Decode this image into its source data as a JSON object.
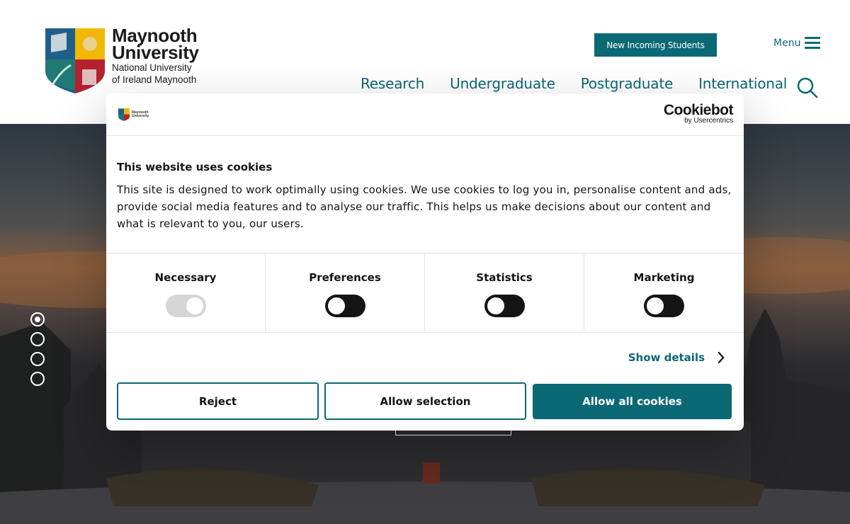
{
  "header": {
    "logo": {
      "name_line1": "Maynooth",
      "name_line2": "University",
      "sub_line1": "National University",
      "sub_line2": "of Ireland Maynooth"
    },
    "cta_label": "New Incoming Students",
    "menu_label": "Menu",
    "nav": [
      {
        "label": "Research"
      },
      {
        "label": "Undergraduate"
      },
      {
        "label": "Postgraduate"
      },
      {
        "label": "International"
      }
    ]
  },
  "hero": {
    "slides_count": 4,
    "active_slide": 1
  },
  "cookie_dialog": {
    "brand_name": "Cookiebot",
    "brand_by": "by Usercentrics",
    "mini_logo_line1": "Maynooth",
    "mini_logo_line2": "University",
    "title": "This website uses cookies",
    "body": "This site is designed to work optimally using cookies. We use cookies to log you in, personalise content and ads, provide social media features and to analyse our traffic. This helps us make decisions about our content and what is relevant to you, our users.",
    "categories": [
      {
        "label": "Necessary",
        "state": "on-disabled"
      },
      {
        "label": "Preferences",
        "state": "off"
      },
      {
        "label": "Statistics",
        "state": "off"
      },
      {
        "label": "Marketing",
        "state": "off"
      }
    ],
    "show_details": "Show details",
    "buttons": {
      "reject": "Reject",
      "allow_selection": "Allow selection",
      "allow_all": "Allow all cookies"
    }
  },
  "colors": {
    "accent": "#0b6875",
    "text": "#141414",
    "toggle_off": "#141414",
    "toggle_disabled": "#d6d6d6"
  }
}
